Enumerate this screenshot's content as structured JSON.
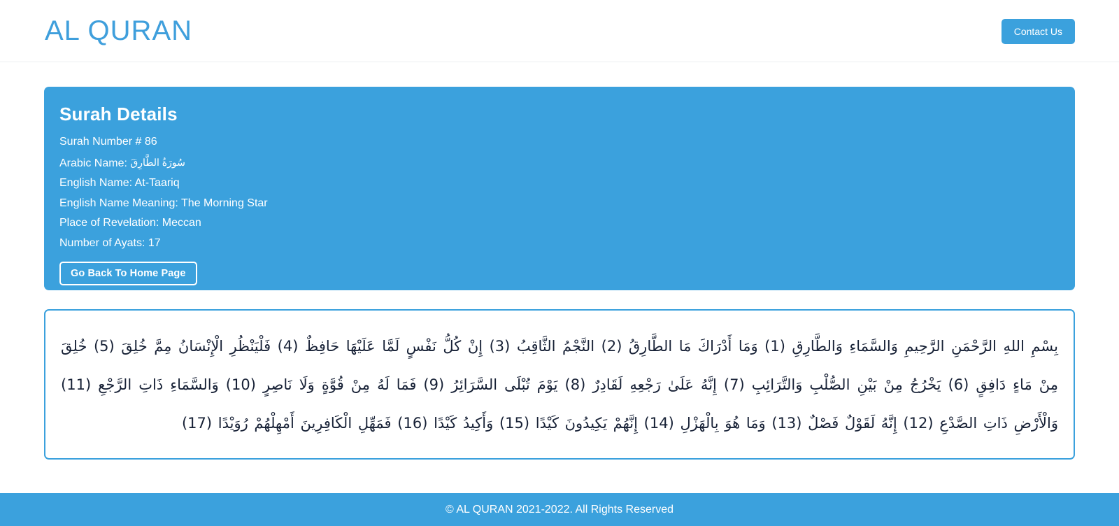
{
  "theme": {
    "accent": "#3ba1dd",
    "brand_text": "#3f9fdc",
    "page_bg": "#ffffff",
    "ayat_text": "#172136",
    "header_divider": "#eceef0"
  },
  "header": {
    "brand": "AL QURAN",
    "contact_label": "Contact Us"
  },
  "details": {
    "title": "Surah Details",
    "surah_number_line": "Surah Number # 86",
    "arabic_name_label": "Arabic Name:",
    "arabic_name_value": "سُورَةُ الطَّارِقَ",
    "english_name_line": "English Name: At-Taariq",
    "english_meaning_line": "English Name Meaning: The Morning Star",
    "revelation_line": "Place of Revelation: Meccan",
    "ayats_line": "Number of Ayats: 17",
    "home_button_label": "Go Back To Home Page"
  },
  "ayat": {
    "text": "بِسْمِ اللهِ الرَّحْمَنِ الرَّحِيمِ وَالسَّمَاءِ وَالطَّارِقِ (1) وَمَا أَدْرَاكَ مَا الطَّارِقُ (2) النَّجْمُ الثَّاقِبُ (3) إِنْ كُلُّ نَفْسٍ لَمَّا عَلَيْهَا حَافِظٌ (4) فَلْيَنْظُرِ الْإِنْسَانُ مِمَّ خُلِقَ (5) خُلِقَ مِنْ مَاءٍ دَافِقٍ (6) يَخْرُجُ مِنْ بَيْنِ الصُّلْبِ وَالتَّرَائِبِ (7) إِنَّهُ عَلَىٰ رَجْعِهِ لَقَادِرٌ (8) يَوْمَ تُبْلَى السَّرَائِرُ (9) فَمَا لَهُ مِنْ قُوَّةٍ وَلَا نَاصِرٍ (10) وَالسَّمَاءِ ذَاتِ الرَّجْعِ (11) وَالْأَرْضِ ذَاتِ الصَّدْعِ (12) إِنَّهُ لَقَوْلٌ فَصْلٌ (13) وَمَا هُوَ بِالْهَزْلِ (14) إِنَّهُمْ يَكِيدُونَ كَيْدًا (15) وَأَكِيدُ كَيْدًا (16) فَمَهِّلِ الْكَافِرِينَ أَمْهِلْهُمْ رُوَيْدًا (17)"
  },
  "footer": {
    "copyright": "© AL QURAN 2021-2022. All Rights Reserved"
  }
}
